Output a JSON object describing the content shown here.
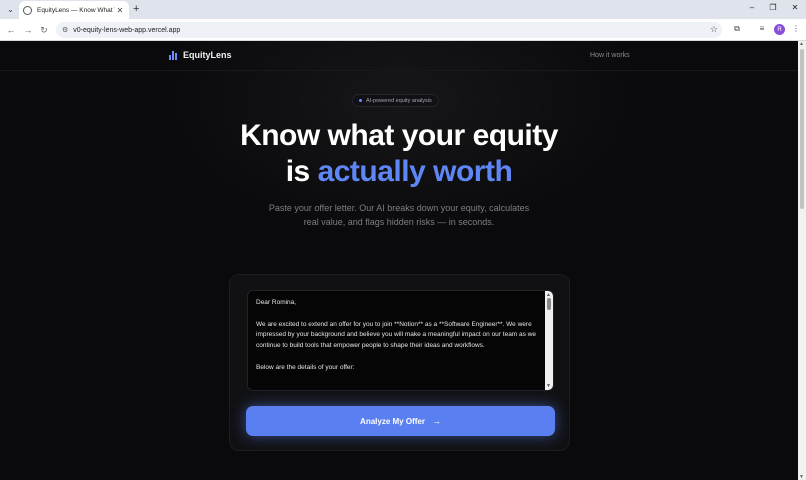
{
  "browser": {
    "tab_title": "EquityLens — Know What Your",
    "url": "v0-equity-lens-web-app.vercel.app",
    "profile_initial": "R",
    "icons": {
      "tab_list": "chevron-down-icon",
      "new_tab": "plus-icon",
      "back": "arrow-left-icon",
      "forward": "arrow-right-icon",
      "reload": "reload-icon",
      "site_info": "tune-icon",
      "bookmark": "star-icon",
      "extensions": "puzzle-icon",
      "media": "queue-music-icon",
      "menu": "kebab-icon"
    }
  },
  "nav": {
    "brand": "EquityLens",
    "link": "How it works"
  },
  "hero": {
    "badge": "AI-powered equity analysis",
    "line1": "Know what your equity",
    "line2_prefix": "is ",
    "line2_accent": "actually worth",
    "subtitle_line1": "Paste your offer letter. Our AI breaks down your equity, calculates",
    "subtitle_line2": "real value, and flags hidden risks — in seconds."
  },
  "offer_input": {
    "para1": "Dear Romina,",
    "para2": "We are excited to extend an offer for you to join **Notion** as a **Software Engineer**. We were impressed by your background and believe you will make a meaningful impact on our team as we continue to build tools that empower people to shape their ideas and workflows.",
    "para3": "Below are the details of your offer:"
  },
  "cta": {
    "label": "Analyze My Offer",
    "icon": "arrow-right-icon"
  },
  "colors": {
    "accent": "#5f86f5",
    "button": "#5a7ff0",
    "background": "#0a0a0c"
  }
}
